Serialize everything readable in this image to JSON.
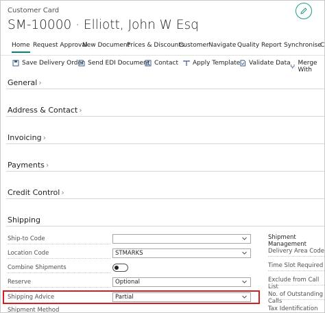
{
  "header": {
    "card_type": "Customer Card",
    "title": "SM-10000 · Elliott, John W Esq"
  },
  "tabs": [
    {
      "label": "Home"
    },
    {
      "label": "Request Approval"
    },
    {
      "label": "New Document"
    },
    {
      "label": "Prices & Discounts"
    },
    {
      "label": "Customer"
    },
    {
      "label": "Navigate"
    },
    {
      "label": "Quality"
    },
    {
      "label": "Report"
    },
    {
      "label": "Synchronise"
    },
    {
      "label": "Cr"
    }
  ],
  "actions": [
    {
      "label": "Save Delivery Order",
      "icon": "save-delivery-order-icon"
    },
    {
      "label": "Send EDI Document",
      "icon": "send-edi-icon"
    },
    {
      "label": "Contact",
      "icon": "contact-icon"
    },
    {
      "label": "Apply Template",
      "icon": "apply-template-icon"
    },
    {
      "label": "Validate Data",
      "icon": "validate-data-icon"
    },
    {
      "label": "Merge With",
      "icon": "merge-icon"
    }
  ],
  "sections": [
    {
      "title": "General"
    },
    {
      "title": "Address & Contact"
    },
    {
      "title": "Invoicing"
    },
    {
      "title": "Payments"
    },
    {
      "title": "Credit Control"
    },
    {
      "title": "Shipping"
    }
  ],
  "shipping": {
    "fields": [
      {
        "label": "Ship-to Code",
        "value": ""
      },
      {
        "label": "Location Code",
        "value": "STMARKS"
      },
      {
        "label": "Combine Shipments",
        "value": ""
      },
      {
        "label": "Reserve",
        "value": "Optional"
      },
      {
        "label": "Shipping Advice",
        "value": "Partial"
      },
      {
        "label": "Shipment Method",
        "value": ""
      }
    ],
    "combine_shipments_on": false,
    "right_group_title": "Shipment Management",
    "right_fields": [
      {
        "label": "Delivery Area Code"
      },
      {
        "label": "Time Slot Required"
      },
      {
        "label": "Exclude from Call List"
      },
      {
        "label": "No. of Outstanding Calls"
      },
      {
        "label": "Tax Identification No."
      }
    ]
  },
  "colors": {
    "accent": "#00857a",
    "highlight": "#d41f1f"
  }
}
